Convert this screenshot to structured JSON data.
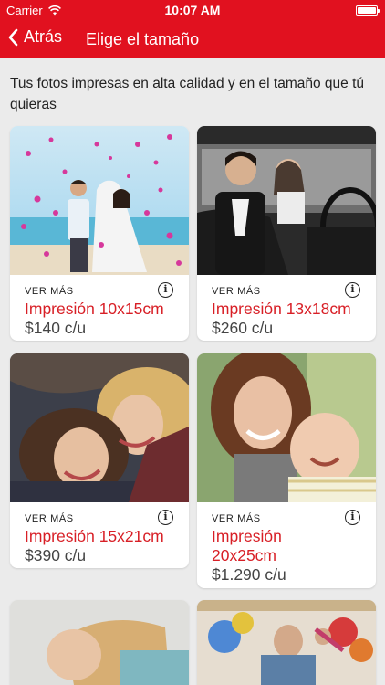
{
  "status_bar": {
    "carrier": "Carrier",
    "time": "10:07 AM"
  },
  "nav": {
    "back_label": "Atrás",
    "title": "Elige el tamaño"
  },
  "intro": "Tus fotos impresas en alta calidad y en el tamaño que tú quieras",
  "products": [
    {
      "ver_mas": "VER MÁS",
      "title": "Impresión 10x15cm",
      "price": "$140 c/u",
      "photo": "wedding-couple-beach-photo"
    },
    {
      "ver_mas": "VER MÁS",
      "title": "Impresión 13x18cm",
      "price": "$260 c/u",
      "photo": "couple-in-car-photo"
    },
    {
      "ver_mas": "VER MÁS",
      "title": "Impresión 15x21cm",
      "price": "$390 c/u",
      "photo": "two-women-lying-photo"
    },
    {
      "ver_mas": "VER MÁS",
      "title_line1": "Impresión",
      "title_line2": "20x25cm",
      "price": "$1.290 c/u",
      "photo": "mother-and-baby-photo"
    },
    {
      "photo": "woman-smiling-photo"
    },
    {
      "photo": "party-balloons-photo"
    }
  ],
  "colors": {
    "header": "#e1111f",
    "accent_text": "#d81f26",
    "background": "#ebebeb"
  },
  "icons": [
    "wifi-icon",
    "battery-icon",
    "chevron-left-icon",
    "info-icon"
  ]
}
